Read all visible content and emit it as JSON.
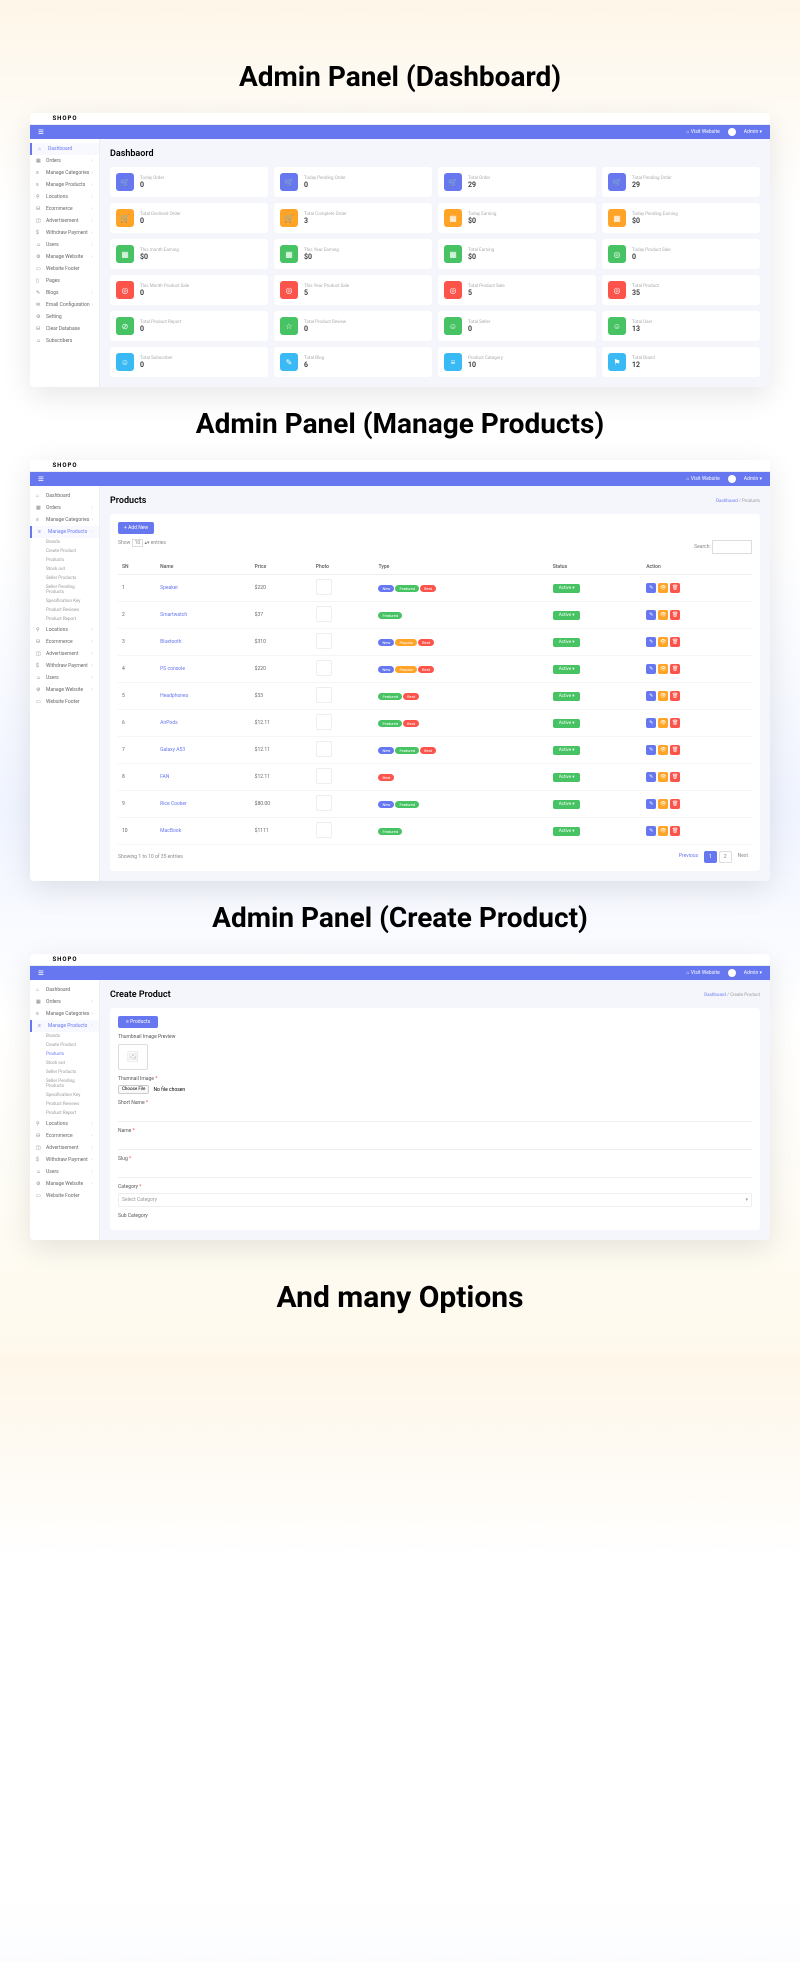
{
  "sections": {
    "dashboard_title": "Admin  Panel (Dashboard)",
    "products_title": "Admin  Panel (Manage Products)",
    "create_title": "Admin  Panel (Create Product)",
    "footer": "And many Options"
  },
  "common": {
    "logo": "SHOPO",
    "visit_website": "Visit Website",
    "user": "Admin",
    "caret": "▾"
  },
  "sidebar": {
    "items": [
      {
        "icon": "⌂",
        "label": "Dashboard"
      },
      {
        "icon": "▦",
        "label": "Orders"
      },
      {
        "icon": "≡",
        "label": "Manage Categories"
      },
      {
        "icon": "≡",
        "label": "Manage Products"
      },
      {
        "icon": "⚲",
        "label": "Locations"
      },
      {
        "icon": "⛁",
        "label": "Ecommerce"
      },
      {
        "icon": "◫",
        "label": "Advertisement"
      },
      {
        "icon": "$",
        "label": "Withdraw Payment"
      },
      {
        "icon": "☺",
        "label": "Users"
      },
      {
        "icon": "⚙",
        "label": "Manage Website"
      },
      {
        "icon": "▭",
        "label": "Website Footer"
      },
      {
        "icon": "▯",
        "label": "Pages"
      },
      {
        "icon": "✎",
        "label": "Blogs"
      },
      {
        "icon": "✉",
        "label": "Email Configuration"
      },
      {
        "icon": "⚙",
        "label": "Setting"
      },
      {
        "icon": "⛁",
        "label": "Clear Database"
      },
      {
        "icon": "☺",
        "label": "Subscribers"
      }
    ],
    "sub_products": [
      "Brands",
      "Create Product",
      "Products",
      "Stock out",
      "Seller Products",
      "Seller Pending Products",
      "Specification Key",
      "Product Reviews",
      "Product Report"
    ],
    "sidebar_short": [
      {
        "icon": "⌂",
        "label": "Dashboard"
      },
      {
        "icon": "▦",
        "label": "Orders"
      },
      {
        "icon": "≡",
        "label": "Manage Categories"
      },
      {
        "icon": "≡",
        "label": "Manage Products"
      },
      {
        "icon": "⚲",
        "label": "Locations"
      },
      {
        "icon": "⛁",
        "label": "Ecommerce"
      },
      {
        "icon": "◫",
        "label": "Advertisement"
      },
      {
        "icon": "$",
        "label": "Withdraw Payment"
      },
      {
        "icon": "☺",
        "label": "Users"
      },
      {
        "icon": "⚙",
        "label": "Manage Website"
      },
      {
        "icon": "▭",
        "label": "Website Footer"
      }
    ]
  },
  "dashboard": {
    "page_title": "Dashbaord",
    "stats": [
      {
        "color": "c-purple",
        "icon": "🛒",
        "label": "Today Order",
        "value": "0"
      },
      {
        "color": "c-purple",
        "icon": "🛒",
        "label": "Today Pending Order",
        "value": "0"
      },
      {
        "color": "c-purple",
        "icon": "🛒",
        "label": "Total Order",
        "value": "29"
      },
      {
        "color": "c-purple",
        "icon": "🛒",
        "label": "Total Pending Order",
        "value": "29"
      },
      {
        "color": "c-orange",
        "icon": "🛒",
        "label": "Total Declined Order",
        "value": "0"
      },
      {
        "color": "c-orange",
        "icon": "🛒",
        "label": "Total Complete Order",
        "value": "3"
      },
      {
        "color": "c-orange",
        "icon": "▦",
        "label": "Today Earning",
        "value": "$0"
      },
      {
        "color": "c-orange",
        "icon": "▦",
        "label": "Today Pending Earning",
        "value": "$0"
      },
      {
        "color": "c-green",
        "icon": "▦",
        "label": "This month Earning",
        "value": "$0"
      },
      {
        "color": "c-green",
        "icon": "▦",
        "label": "This Year Earning",
        "value": "$0"
      },
      {
        "color": "c-green",
        "icon": "▦",
        "label": "Total Earning",
        "value": "$0"
      },
      {
        "color": "c-green",
        "icon": "◎",
        "label": "Today Product Sale",
        "value": "0"
      },
      {
        "color": "c-red",
        "icon": "◎",
        "label": "This Month Product Sale",
        "value": "0"
      },
      {
        "color": "c-red",
        "icon": "◎",
        "label": "This Year Product Sale",
        "value": "5"
      },
      {
        "color": "c-red",
        "icon": "◎",
        "label": "Total Product Sale",
        "value": "5"
      },
      {
        "color": "c-red",
        "icon": "◎",
        "label": "Total Product",
        "value": "35"
      },
      {
        "color": "c-green",
        "icon": "⊘",
        "label": "Total Product Report",
        "value": "0"
      },
      {
        "color": "c-green",
        "icon": "☆",
        "label": "Total Product Review",
        "value": "0"
      },
      {
        "color": "c-green",
        "icon": "☺",
        "label": "Total Seller",
        "value": "0"
      },
      {
        "color": "c-green",
        "icon": "☺",
        "label": "Total User",
        "value": "13"
      },
      {
        "color": "c-cyan",
        "icon": "☺",
        "label": "Total Subscriber",
        "value": "0"
      },
      {
        "color": "c-cyan",
        "icon": "✎",
        "label": "Total Blog",
        "value": "6"
      },
      {
        "color": "c-cyan",
        "icon": "≡",
        "label": "Product Category",
        "value": "10"
      },
      {
        "color": "c-cyan",
        "icon": "⚑",
        "label": "Total Brand",
        "value": "12"
      }
    ]
  },
  "products": {
    "page_title": "Products",
    "breadcrumb_dashboard": "Dashboard",
    "breadcrumb_current": "Products",
    "add_button": "+ Add New",
    "show_label": "Show",
    "show_count": "10",
    "entries_label": "entries",
    "search_label": "Search:",
    "headers": {
      "sn": "SN",
      "name": "Name",
      "price": "Price",
      "photo": "Photo",
      "type": "Type",
      "status": "Status",
      "action": "Action"
    },
    "rows": [
      {
        "sn": "1",
        "name": "Speaker",
        "price": "$220",
        "types": [
          "b-new",
          "b-featured",
          "b-best"
        ],
        "type_labels": [
          "New",
          "Featured",
          "Best"
        ],
        "status": "Active"
      },
      {
        "sn": "2",
        "name": "Smartwatch",
        "price": "$37",
        "types": [
          "b-featured"
        ],
        "type_labels": [
          "Featured"
        ],
        "status": "Active"
      },
      {
        "sn": "3",
        "name": "Bluetooth",
        "price": "$310",
        "types": [
          "b-new",
          "b-popular",
          "b-best"
        ],
        "type_labels": [
          "New",
          "Popular",
          "Best"
        ],
        "status": "Active"
      },
      {
        "sn": "4",
        "name": "PS console",
        "price": "$220",
        "types": [
          "b-new",
          "b-popular",
          "b-best"
        ],
        "type_labels": [
          "New",
          "Popular",
          "Best"
        ],
        "status": "Active"
      },
      {
        "sn": "5",
        "name": "Headphones",
        "price": "$33",
        "types": [
          "b-featured",
          "b-best"
        ],
        "type_labels": [
          "Featured",
          "Best"
        ],
        "status": "Active"
      },
      {
        "sn": "6",
        "name": "AirPods",
        "price": "$12.11",
        "types": [
          "b-featured",
          "b-best"
        ],
        "type_labels": [
          "Featured",
          "Best"
        ],
        "status": "Active"
      },
      {
        "sn": "7",
        "name": "Galaxy A53",
        "price": "$12.11",
        "types": [
          "b-new",
          "b-featured",
          "b-best"
        ],
        "type_labels": [
          "New",
          "Featured",
          "Best"
        ],
        "status": "Active"
      },
      {
        "sn": "8",
        "name": "FAN",
        "price": "$12.11",
        "types": [
          "b-best"
        ],
        "type_labels": [
          "Best"
        ],
        "status": "Active"
      },
      {
        "sn": "9",
        "name": "Rice Cooker",
        "price": "$80.00",
        "types": [
          "b-new",
          "b-featured"
        ],
        "type_labels": [
          "New",
          "Featured"
        ],
        "status": "Active"
      },
      {
        "sn": "10",
        "name": "MacBook",
        "price": "$1111",
        "types": [
          "b-featured"
        ],
        "type_labels": [
          "Featured"
        ],
        "status": "Active"
      }
    ],
    "footer_info": "Showing 1 to 10 of 35 entries",
    "prev": "Previous",
    "next": "Next",
    "page1": "1",
    "page2": "2"
  },
  "create": {
    "page_title": "Create Product",
    "breadcrumb_dashboard": "Dashboard",
    "breadcrumb_current": "Create Product",
    "tab_label": "≡ Products",
    "thumb_preview_label": "Thumbnail Image Preview",
    "thumb_label": "Thumnail Image",
    "choose_file": "Choose File",
    "no_file": "No file chosen",
    "short_name": "Short Name",
    "name": "Name",
    "slug": "Slug",
    "category": "Category",
    "select_category": "Select Category",
    "sub_category": "Sub Category"
  }
}
